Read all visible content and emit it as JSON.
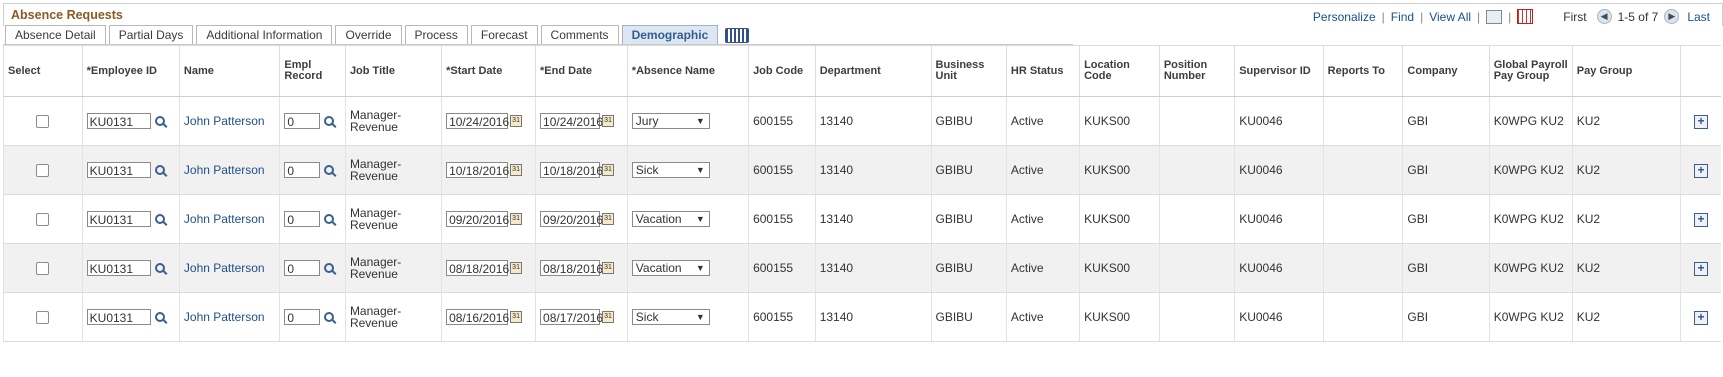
{
  "header": {
    "title": "Absence Requests",
    "personalize": "Personalize",
    "find": "Find",
    "view_all": "View All",
    "first": "First",
    "range": "1-5 of 7",
    "last": "Last",
    "sep": "|"
  },
  "tabs": [
    {
      "label": "Absence Detail",
      "active": false
    },
    {
      "label": "Partial Days",
      "active": false
    },
    {
      "label": "Additional Information",
      "active": false
    },
    {
      "label": "Override",
      "active": false
    },
    {
      "label": "Process",
      "active": false
    },
    {
      "label": "Forecast",
      "active": false
    },
    {
      "label": "Comments",
      "active": false
    },
    {
      "label": "Demographic",
      "active": true
    }
  ],
  "columns": {
    "select": "Select",
    "employee_id": "*Employee ID",
    "name": "Name",
    "empl_record": "Empl Record",
    "job_title": "Job Title",
    "start_date": "*Start Date",
    "end_date": "*End Date",
    "absence_name": "*Absence Name",
    "job_code": "Job Code",
    "department": "Department",
    "business_unit": "Business Unit",
    "hr_status": "HR Status",
    "location_code": "Location Code",
    "position_number": "Position Number",
    "supervisor_id": "Supervisor ID",
    "reports_to": "Reports To",
    "company": "Company",
    "global_payroll_pay_group": "Global Payroll Pay Group",
    "pay_group": "Pay Group"
  },
  "rows": [
    {
      "employee_id": "KU0131",
      "name": "John Patterson",
      "empl_record": "0",
      "job_title": "Manager-Revenue",
      "start_date": "10/24/2016",
      "end_date": "10/24/2016",
      "absence_name": "Jury",
      "job_code": "600155",
      "department": "13140",
      "business_unit": "GBIBU",
      "hr_status": "Active",
      "location_code": "KUKS00",
      "position_number": "",
      "supervisor_id": "KU0046",
      "reports_to": "",
      "company": "GBI",
      "global_payroll_pay_group": "K0WPG KU2",
      "pay_group": "KU2"
    },
    {
      "employee_id": "KU0131",
      "name": "John Patterson",
      "empl_record": "0",
      "job_title": "Manager-Revenue",
      "start_date": "10/18/2016",
      "end_date": "10/18/2016",
      "absence_name": "Sick",
      "job_code": "600155",
      "department": "13140",
      "business_unit": "GBIBU",
      "hr_status": "Active",
      "location_code": "KUKS00",
      "position_number": "",
      "supervisor_id": "KU0046",
      "reports_to": "",
      "company": "GBI",
      "global_payroll_pay_group": "K0WPG KU2",
      "pay_group": "KU2"
    },
    {
      "employee_id": "KU0131",
      "name": "John Patterson",
      "empl_record": "0",
      "job_title": "Manager-Revenue",
      "start_date": "09/20/2016",
      "end_date": "09/20/2016",
      "absence_name": "Vacation",
      "job_code": "600155",
      "department": "13140",
      "business_unit": "GBIBU",
      "hr_status": "Active",
      "location_code": "KUKS00",
      "position_number": "",
      "supervisor_id": "KU0046",
      "reports_to": "",
      "company": "GBI",
      "global_payroll_pay_group": "K0WPG KU2",
      "pay_group": "KU2"
    },
    {
      "employee_id": "KU0131",
      "name": "John Patterson",
      "empl_record": "0",
      "job_title": "Manager-Revenue",
      "start_date": "08/18/2016",
      "end_date": "08/18/2016",
      "absence_name": "Vacation",
      "job_code": "600155",
      "department": "13140",
      "business_unit": "GBIBU",
      "hr_status": "Active",
      "location_code": "KUKS00",
      "position_number": "",
      "supervisor_id": "KU0046",
      "reports_to": "",
      "company": "GBI",
      "global_payroll_pay_group": "K0WPG KU2",
      "pay_group": "KU2"
    },
    {
      "employee_id": "KU0131",
      "name": "John Patterson",
      "empl_record": "0",
      "job_title": "Manager-Revenue",
      "start_date": "08/16/2016",
      "end_date": "08/17/2016",
      "absence_name": "Sick",
      "job_code": "600155",
      "department": "13140",
      "business_unit": "GBIBU",
      "hr_status": "Active",
      "location_code": "KUKS00",
      "position_number": "",
      "supervisor_id": "KU0046",
      "reports_to": "",
      "company": "GBI",
      "global_payroll_pay_group": "K0WPG KU2",
      "pay_group": "KU2"
    }
  ],
  "colors": {
    "title": "#8a5a23",
    "link": "#1d4f8c",
    "active_tab_bg": "#dde7f3",
    "alt_row": "#f1f1f1"
  },
  "icons": [
    "zoom-icon",
    "grid-download-icon",
    "first-arrow-icon",
    "next-arrow-icon",
    "lookup-icon",
    "calendar-icon",
    "dropdown-arrow-icon",
    "add-row-icon",
    "show-all-columns-icon"
  ]
}
